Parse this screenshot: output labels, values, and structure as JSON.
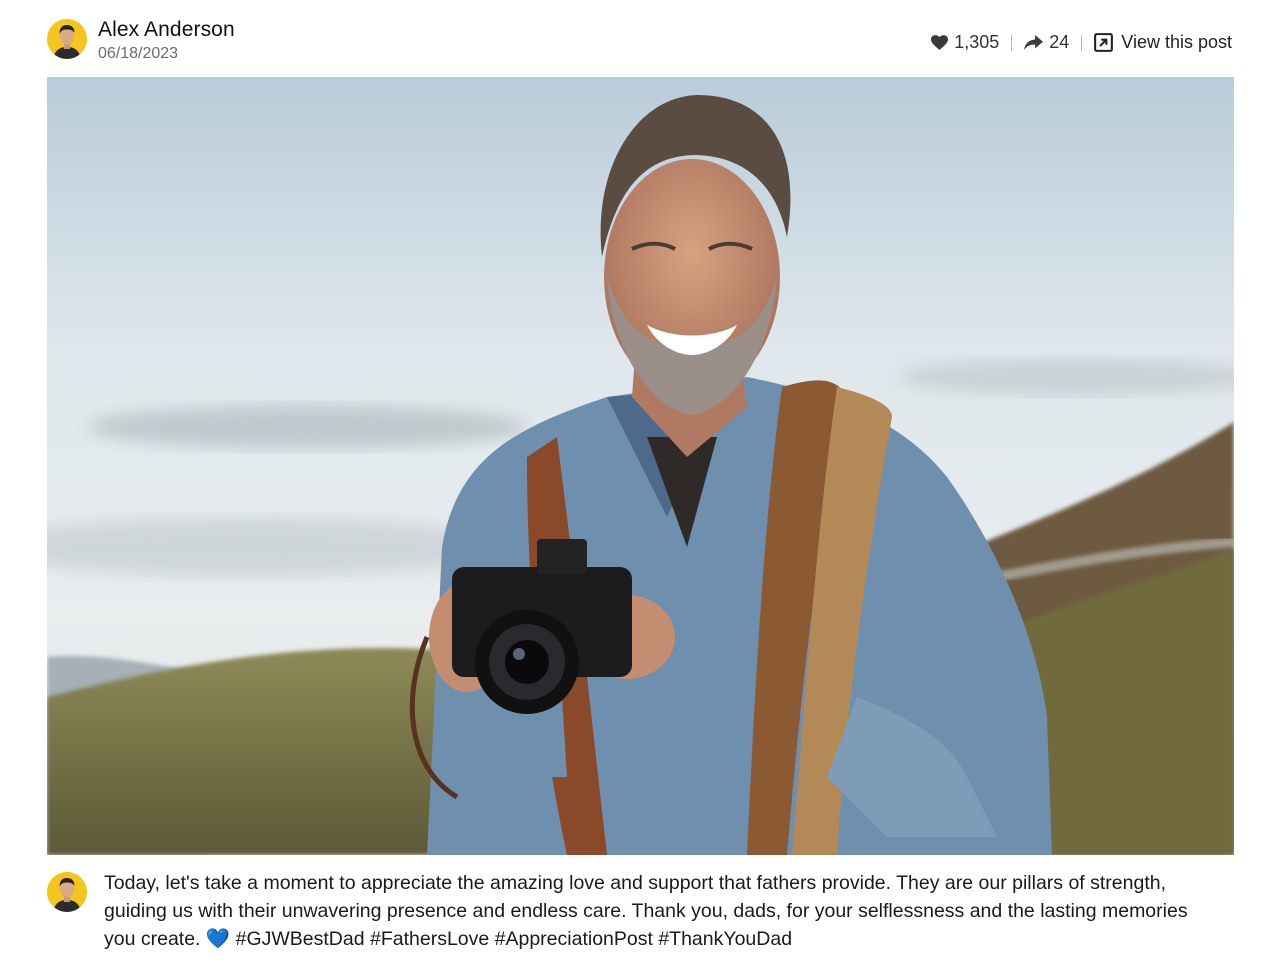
{
  "post": {
    "author": "Alex Anderson",
    "date": "06/18/2023",
    "likes": "1,305",
    "shares": "24",
    "view_label": "View this post",
    "image_alt": "Smiling bearded man in a denim shirt holding a camera outdoors",
    "caption_text": "Today, let's take a moment to appreciate the amazing love and support that fathers provide. They are our pillars of strength, guiding us with their unwavering presence and endless care. Thank you, dads, for your selflessness and the lasting memories you create.",
    "caption_emoji": "💙",
    "hashtags": "#GJWBestDad #FathersLove #AppreciationPost #ThankYouDad"
  },
  "colors": {
    "avatar_bg": "#f4c51c",
    "text": "#1a1a1a",
    "muted": "#6b6b6b"
  },
  "icons": [
    "avatar",
    "heart-icon",
    "share-arrow-icon",
    "external-link-icon",
    "blue-heart-emoji"
  ]
}
